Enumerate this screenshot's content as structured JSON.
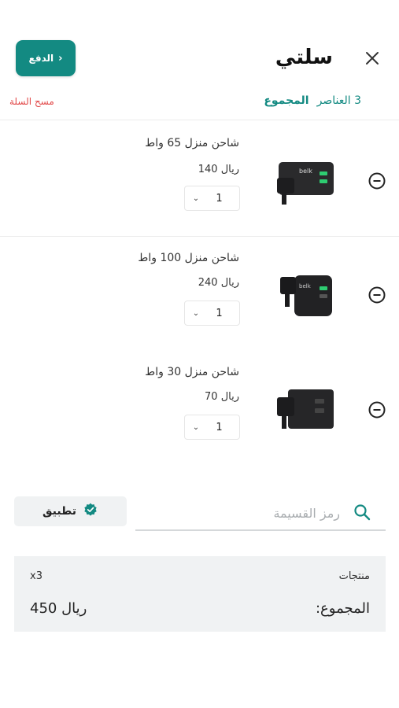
{
  "header": {
    "title": "سلتي",
    "checkout_label": "الدفع",
    "total_label": "المجموع",
    "total_count": "3 العناصر",
    "clear_cart": "مسح السلة"
  },
  "items": [
    {
      "name": "شاحن منزل 65 واط",
      "price": "ريال 140",
      "qty": "1",
      "brand_mark": "belk"
    },
    {
      "name": "شاحن منزل 100 واط",
      "price": "ريال 240",
      "qty": "1",
      "brand_mark": "belk"
    },
    {
      "name": "شاحن منزل 30 واط",
      "price": "ريال 70",
      "qty": "1",
      "brand_mark": ""
    }
  ],
  "coupon": {
    "placeholder": "رمز القسيمة",
    "apply_label": "تطبيق"
  },
  "summary": {
    "products_label": "منتجات",
    "products_value": "x3",
    "total_label": "المجموع:",
    "total_value": "ريال 450"
  },
  "colors": {
    "accent": "#138a82",
    "danger": "#e24a4a",
    "panel": "#f0f2f3"
  },
  "icons": [
    "close-icon",
    "chevron-right-icon",
    "remove-circle-icon",
    "chevron-down-icon",
    "search-icon",
    "verified-badge-icon"
  ]
}
